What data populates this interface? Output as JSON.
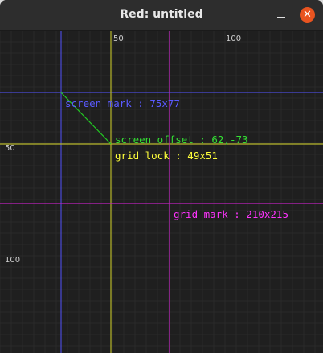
{
  "window": {
    "title": "Red: untitled",
    "minimize_icon": "minimize-icon",
    "close_icon": "close-icon",
    "close_glyph": "✕",
    "close_color": "#e95420"
  },
  "canvas": {
    "background": "#1f1f1f",
    "grid_color": "#2a2a2a",
    "ticks": {
      "x_50": "50",
      "x_100": "100",
      "y_50": "50",
      "y_100": "100"
    },
    "screen_mark": {
      "text": "screen mark : 75x77",
      "color": "#5a5aff"
    },
    "grid_lock": {
      "text": "grid lock : 49x51",
      "color": "#ffff3a"
    },
    "screen_offset": {
      "text": "screen offset : 62,-73",
      "color": "#33e033"
    },
    "grid_mark": {
      "text": "grid mark : 210x215",
      "color": "#ff33ff"
    }
  }
}
